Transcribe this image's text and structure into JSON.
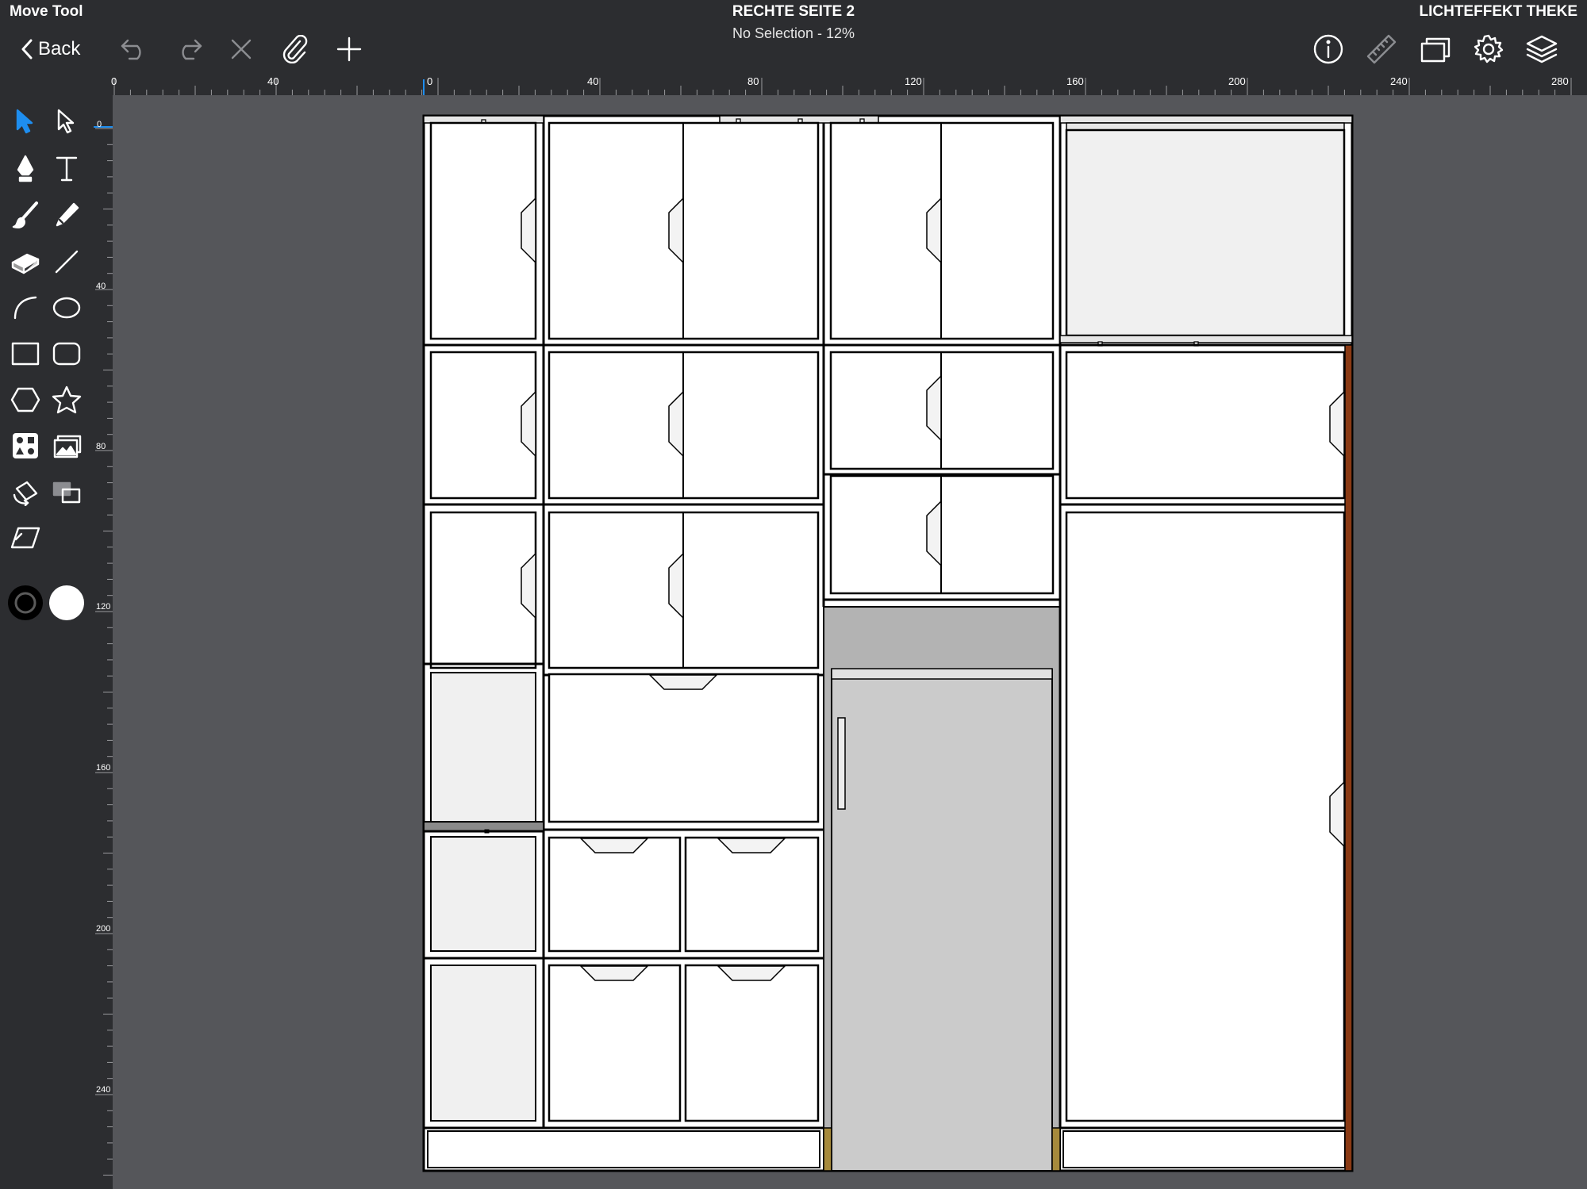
{
  "header": {
    "mode_label": "Move Tool",
    "title": "RECHTE SEITE 2",
    "subtitle": "No Selection - 12%",
    "document_name": "LICHTEFFEKT THEKE"
  },
  "toolbar": {
    "back_label": "Back",
    "left_icons": [
      "undo-icon",
      "redo-icon",
      "delete-icon",
      "attach-icon",
      "add-icon"
    ],
    "right_icons": [
      "info-icon",
      "ruler-icon",
      "artboards-icon",
      "settings-icon",
      "layers-icon"
    ]
  },
  "tools": [
    "selection-arrow",
    "direct-selection-arrow",
    "pen",
    "text",
    "brush",
    "pencil",
    "eraser",
    "line",
    "arc",
    "ellipse",
    "rectangle",
    "rounded-rectangle",
    "polygon",
    "star",
    "shapes-library",
    "image-import",
    "transform",
    "artboard",
    "skew"
  ],
  "colors": {
    "stroke": "#000000",
    "fill": "#ffffff",
    "accent": "#1e8ef0",
    "chrome": "#2c2d30",
    "canvas": "#55565a"
  },
  "rulers": {
    "horizontal": [
      "0",
      "40",
      "0",
      "40",
      "80",
      "120",
      "160",
      "200",
      "240",
      "280"
    ],
    "vertical": [
      "0",
      "40",
      "80",
      "120",
      "160",
      "200",
      "240"
    ]
  }
}
